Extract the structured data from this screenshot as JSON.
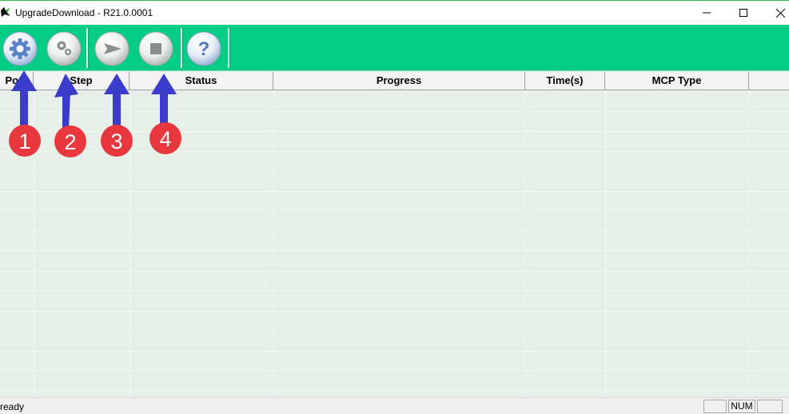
{
  "window": {
    "title": "UpgradeDownload - R21.0.0001",
    "controls": [
      "minimize",
      "maximize",
      "close"
    ]
  },
  "toolbar": {
    "buttons": [
      {
        "icon": "gear-icon",
        "label": ""
      },
      {
        "icon": "gears-icon",
        "label": ""
      },
      {
        "icon": "start-arrow-icon",
        "label": ""
      },
      {
        "icon": "stop-icon",
        "label": ""
      },
      {
        "icon": "help-icon",
        "label": "?"
      }
    ],
    "colors": {
      "background": "#06cd85"
    }
  },
  "table": {
    "columns": [
      "Port",
      "Step",
      "Status",
      "Progress",
      "Time(s)",
      "MCP Type"
    ],
    "rows": []
  },
  "annotations": {
    "markers": [
      "1",
      "2",
      "3",
      "4"
    ],
    "arrow_color": "#3c3ccc",
    "marker_color": "#e8383d"
  },
  "statusbar": {
    "text": "ready",
    "panes": [
      "",
      "NUM",
      ""
    ]
  }
}
